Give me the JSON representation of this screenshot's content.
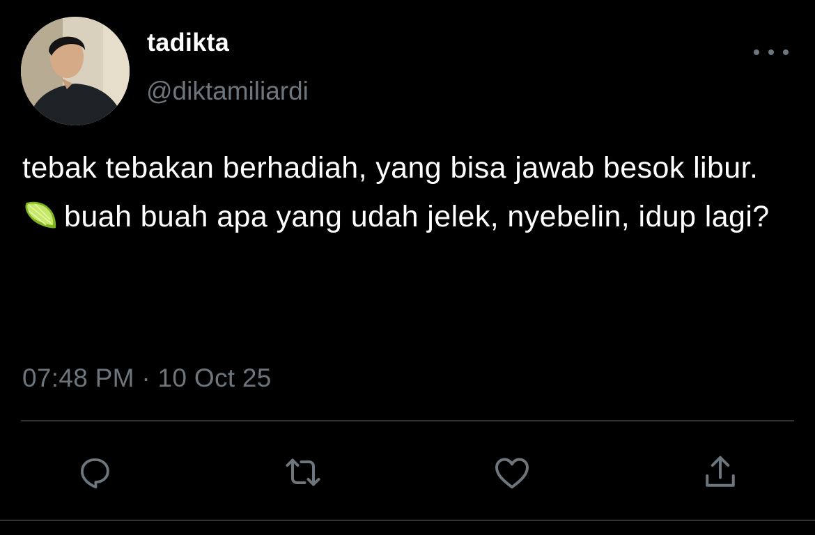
{
  "tweet": {
    "display_name": "tadikta",
    "handle": "@diktamiliardi",
    "text_line_1": "tebak tebakan berhadiah, yang bisa jawab besok libur.",
    "text_line_2": "buah buah apa yang udah jelek, nyebelin, idup lagi?",
    "emoji": "lime-emoji",
    "timestamp": "07:48 PM · 10 Oct 25"
  },
  "actions": {
    "icons": [
      "reply-icon",
      "retweet-icon",
      "like-icon",
      "share-icon"
    ]
  },
  "colors": {
    "background": "#000000",
    "text_primary": "#ffffff",
    "text_secondary": "#6e767d",
    "divider": "#2f3336"
  }
}
